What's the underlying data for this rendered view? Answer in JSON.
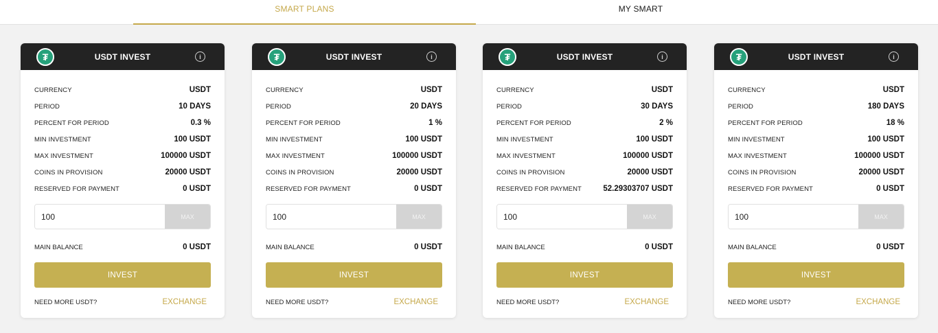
{
  "tabs": {
    "smart_plans": "SMART PLANS",
    "my_smart": "MY SMART"
  },
  "colors": {
    "accent": "#c5a84a",
    "button": "#c5b052",
    "header": "#232323",
    "tether": "#26a17b"
  },
  "labels": {
    "currency": "CURRENCY",
    "period": "PERIOD",
    "percent": "PERCENT FOR PERIOD",
    "min": "MIN INVESTMENT",
    "max": "MAX INVESTMENT",
    "coins": "COINS IN PROVISION",
    "reserved": "RESERVED FOR PAYMENT",
    "max_button": "MAX",
    "main_balance": "MAIN BALANCE",
    "invest": "INVEST",
    "need_more": "NEED MORE USDT?",
    "exchange": "EXCHANGE"
  },
  "plans": [
    {
      "title": "USDT INVEST",
      "icon": "tether-icon",
      "currency": "USDT",
      "period": "10 DAYS",
      "percent": "0.3 %",
      "min": "100 USDT",
      "max": "100000 USDT",
      "coins": "20000 USDT",
      "reserved": "0 USDT",
      "amount": "100",
      "main_balance": "0 USDT"
    },
    {
      "title": "USDT INVEST",
      "icon": "tether-icon",
      "currency": "USDT",
      "period": "20 DAYS",
      "percent": "1 %",
      "min": "100 USDT",
      "max": "100000 USDT",
      "coins": "20000 USDT",
      "reserved": "0 USDT",
      "amount": "100",
      "main_balance": "0 USDT"
    },
    {
      "title": "USDT INVEST",
      "icon": "tether-icon",
      "currency": "USDT",
      "period": "30 DAYS",
      "percent": "2 %",
      "min": "100 USDT",
      "max": "100000 USDT",
      "coins": "20000 USDT",
      "reserved": "52.29303707 USDT",
      "amount": "100",
      "main_balance": "0 USDT"
    },
    {
      "title": "USDT INVEST",
      "icon": "tether-icon",
      "currency": "USDT",
      "period": "180 DAYS",
      "percent": "18 %",
      "min": "100 USDT",
      "max": "100000 USDT",
      "coins": "20000 USDT",
      "reserved": "0 USDT",
      "amount": "100",
      "main_balance": "0 USDT"
    }
  ]
}
